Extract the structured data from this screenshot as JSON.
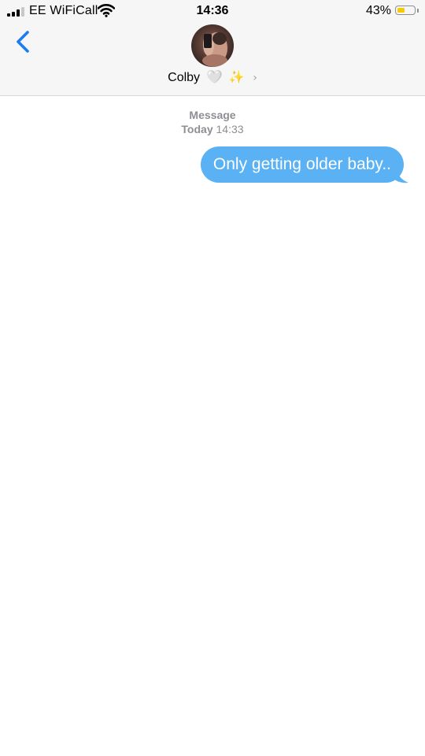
{
  "status_bar": {
    "carrier": "EE WiFiCall",
    "time": "14:36",
    "battery_percent_text": "43%",
    "battery_level": 0.43,
    "signal_bars_filled": 3,
    "signal_bars_total": 4
  },
  "header": {
    "contact_name": "Colby",
    "contact_emoji": [
      "🤍",
      "✨"
    ],
    "back_icon": "chevron-left-icon",
    "details_icon": "chevron-right-icon"
  },
  "thread": {
    "service_label": "Message",
    "timestamp_day": "Today",
    "timestamp_time": "14:33",
    "messages": [
      {
        "direction": "outgoing",
        "text": "Only getting older baby.."
      }
    ]
  },
  "colors": {
    "accent": "#1a7cf5",
    "bubble_outgoing": "#5ab1f4",
    "battery_fill": "#f6c900",
    "header_bg": "#f6f6f6",
    "secondary_text": "#8e8e93"
  }
}
